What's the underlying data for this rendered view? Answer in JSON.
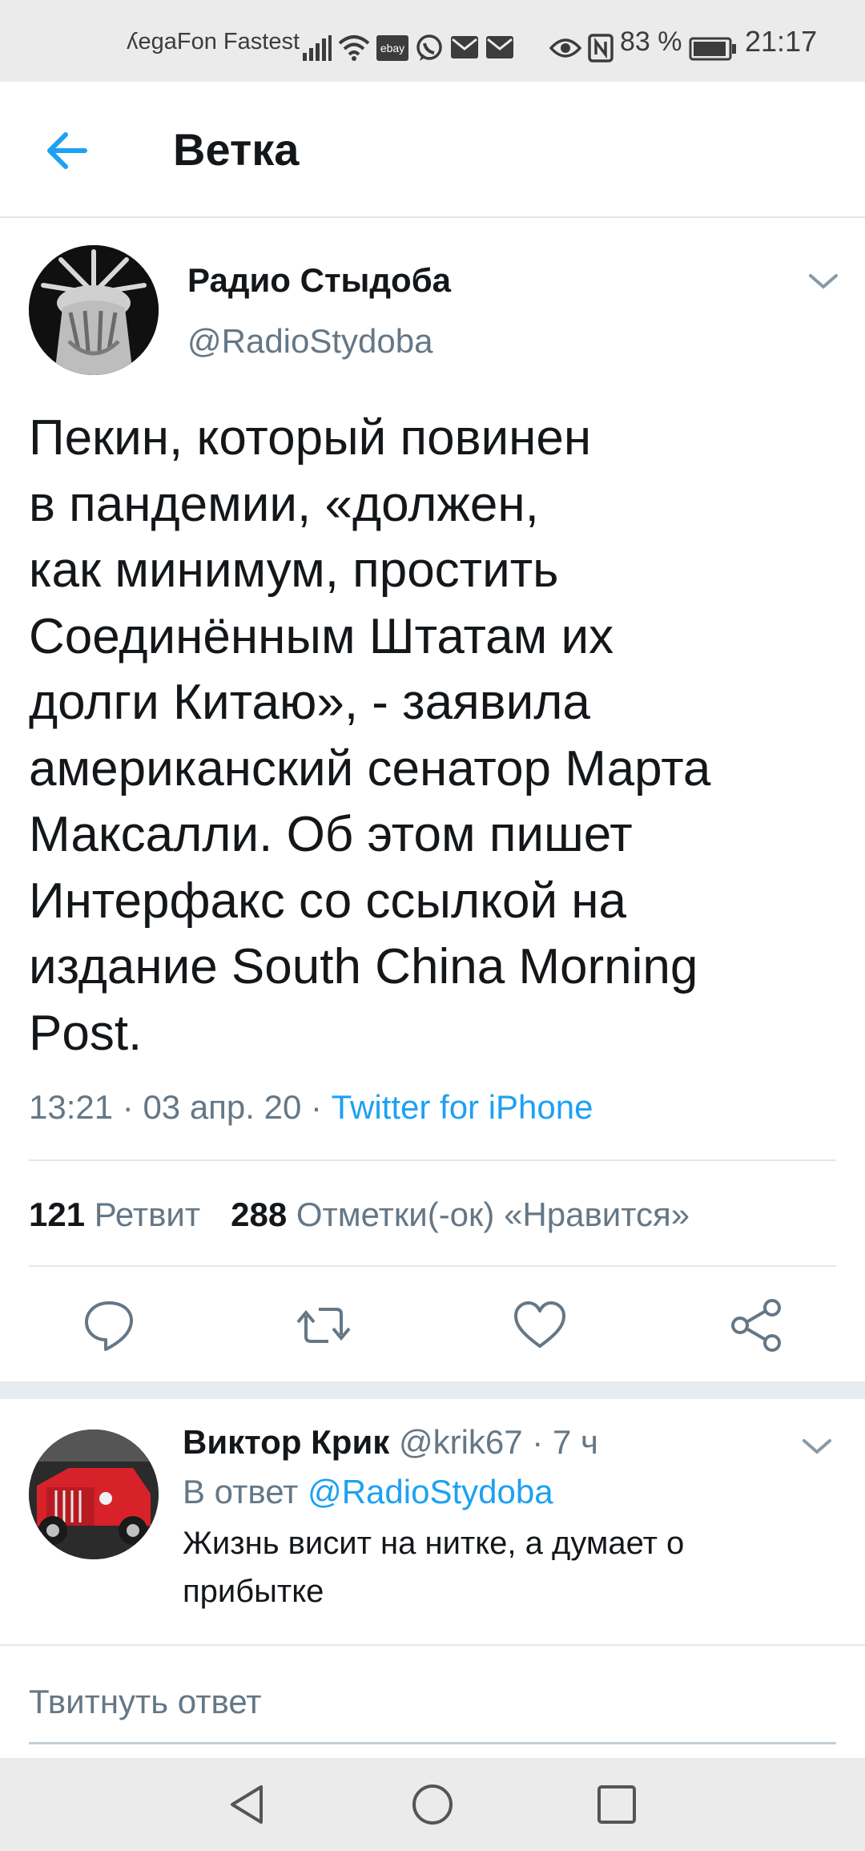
{
  "status_bar": {
    "carrier": "ʎegaFon Fastest",
    "battery": "83 %",
    "time": "21:17",
    "ebay_label": "ebay"
  },
  "header": {
    "title": "Ветка"
  },
  "tweet": {
    "author_name": "Радио Стыдоба",
    "author_handle": "@RadioStydoba",
    "text": "Пекин, который повинен\nв пандемии, «должен,\nкак минимум, простить\nСоединённым Штатам их\nдолги Китаю», - заявила\nамериканский сенатор Марта\nМаксалли. Об этом пишет\nИнтерфакс со ссылкой на\nиздание South China Morning\nPost.",
    "time": "13:21",
    "date": "03 апр. 20",
    "source": "Twitter for iPhone",
    "retweet_count": "121",
    "retweet_label": "Ретвит",
    "like_count": "288",
    "like_label": "Отметки(-ок) «Нравится»"
  },
  "reply": {
    "author_name": "Виктор Крик",
    "author_handle": "@krik67",
    "age": "7 ч",
    "in_reply_prefix": "В ответ",
    "in_reply_handle": "@RadioStydoba",
    "text": "Жизнь висит на нитке, а думает о\nприбытке"
  },
  "compose": {
    "placeholder": "Твитнуть ответ"
  },
  "colors": {
    "accent": "#1da1f2",
    "text": "#14171a",
    "muted": "#657786",
    "divider": "#e1e8ed"
  },
  "icons": [
    "back-arrow-icon",
    "chevron-down-icon",
    "reply-icon",
    "retweet-icon",
    "like-icon",
    "share-icon",
    "nav-back-icon",
    "nav-home-icon",
    "nav-recents-icon"
  ]
}
